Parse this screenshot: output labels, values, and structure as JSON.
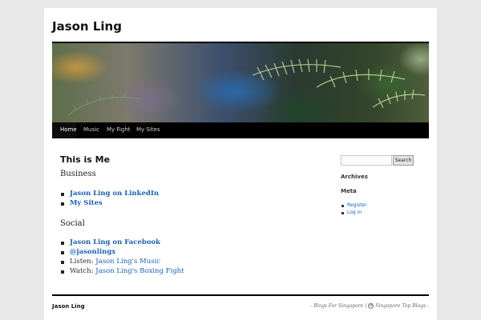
{
  "site": {
    "title": "Jason Ling"
  },
  "nav": {
    "items": [
      {
        "label": "Home",
        "active": true
      },
      {
        "label": "Music",
        "active": false
      },
      {
        "label": "My Fight",
        "active": false
      },
      {
        "label": "My Sites",
        "active": false
      }
    ]
  },
  "main": {
    "heading": "This is Me",
    "business": {
      "label": "Business",
      "links": [
        "Jason Ling on LinkedIn",
        "My Sites"
      ]
    },
    "social": {
      "label": "Social",
      "items": [
        {
          "prefix": "",
          "link": "Jason Ling on Facebook"
        },
        {
          "prefix": "",
          "link": "@jasonlingx"
        },
        {
          "prefix": "Listen: ",
          "link": "Jason Ling's Music"
        },
        {
          "prefix": "Watch: ",
          "link": "Jason Ling's Boxing Fight"
        }
      ]
    }
  },
  "sidebar": {
    "search": {
      "value": "",
      "button_label": "Search"
    },
    "archives_title": "Archives",
    "meta_title": "Meta",
    "meta_links": [
      "Register",
      "Log in"
    ]
  },
  "footer": {
    "title": "Jason Ling",
    "link_one": "- Blogs For Singapore",
    "separator": "|",
    "link_two": "Singapore Top Blogs -",
    "wp_icon": "wordpress-icon"
  },
  "colors": {
    "link": "#1b60b3",
    "nav_bg": "#000000",
    "page_bg": "#e8e8e8"
  }
}
